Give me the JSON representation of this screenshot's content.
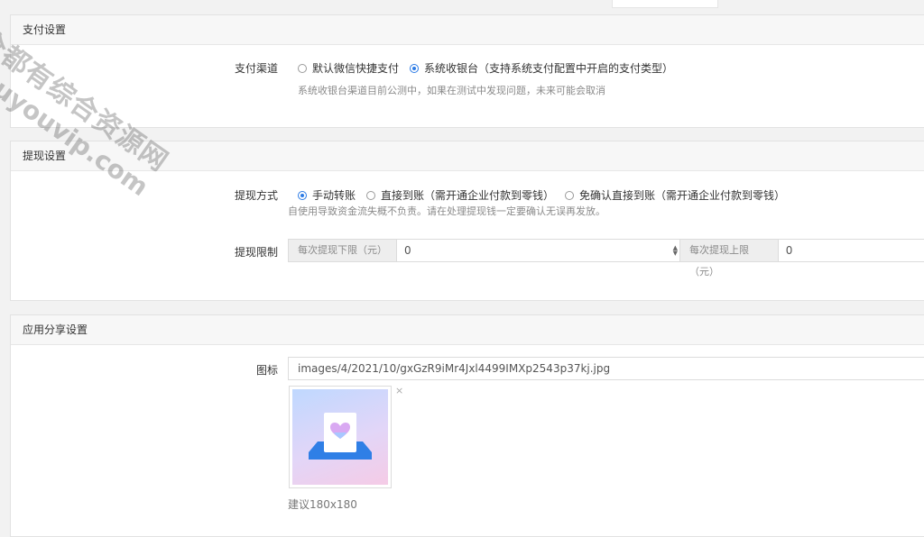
{
  "payment": {
    "header": "支付设置",
    "channel_label": "支付渠道",
    "options": [
      "默认微信快捷支付",
      "系统收银台（支持系统支付配置中开启的支付类型）"
    ],
    "selected_index": 1,
    "hint": "系统收银台渠道目前公测中，如果在测试中发现问题，未来可能会取消"
  },
  "withdraw": {
    "header": "提现设置",
    "method_label": "提现方式",
    "options": [
      "手动转账",
      "直接到账（需开通企业付款到零钱）",
      "免确认直接到账（需开通企业付款到零钱）"
    ],
    "selected_index": 0,
    "hint": "自使用导致资金流失概不负责。请在处理提现钱一定要确认无误再发放。",
    "limit_label": "提现限制",
    "min_addon": "每次提现下限（元）",
    "min_value": "0",
    "max_addon": "每次提现上限（元）",
    "max_value": "0"
  },
  "share": {
    "header": "应用分享设置",
    "icon_label": "图标",
    "icon_path": "images/4/2021/10/gxGzR9iMr4Jxl4499IMXp2543p37kj.jpg",
    "remove_symbol": "×",
    "size_hint": "建议180x180"
  },
  "watermark": {
    "line1": "全都有综合资源网",
    "line2": "douyouvip.com"
  },
  "icons": {
    "remove": "close-icon",
    "spinner": "stepper-arrows-icon"
  },
  "colors": {
    "accent": "#2c7be5",
    "panel_header_bg": "#f7f7f7"
  }
}
